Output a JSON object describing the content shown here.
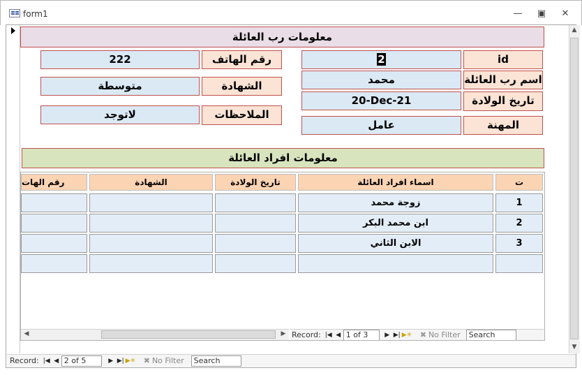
{
  "window": {
    "title": "form1",
    "minimize_icon": "minimize-icon",
    "restore_icon": "restore-icon",
    "close_icon": "close-icon"
  },
  "head_section": {
    "title": "معلومات رب العائلة",
    "fields": {
      "id_label": "id",
      "id_value": "2",
      "name_label": "اسم رب العائلة",
      "name_value": "محمد",
      "dob_label": "تاريخ الولادة",
      "dob_value": "20-Dec-21",
      "job_label": "المهنة",
      "job_value": "عامل",
      "phone_label": "رقم الهاتف",
      "phone_value": "222",
      "degree_label": "الشهادة",
      "degree_value": "متوسطة",
      "notes_label": "الملاحظات",
      "notes_value": "لاتوجد"
    }
  },
  "members_section": {
    "title": "معلومات افراد العائلة",
    "columns": [
      "ت",
      "اسماء افراد العائلة",
      "تاريخ الولادة",
      "الشهادة",
      "رقم الهات"
    ],
    "rows": [
      [
        "1",
        "زوجة محمد",
        "",
        "",
        ""
      ],
      [
        "2",
        "ابن محمد البكر",
        "",
        "",
        ""
      ],
      [
        "3",
        "الابن الثاني",
        "",
        "",
        ""
      ],
      [
        "",
        "",
        "",
        "",
        ""
      ]
    ],
    "nav": {
      "record_label": "Record:",
      "position": "1 of 3",
      "filter": "No Filter",
      "search": "Search"
    }
  },
  "main_nav": {
    "record_label": "Record:",
    "position": "2 of 5",
    "filter": "No Filter",
    "search": "Search"
  },
  "colors": {
    "label_bg": "#fbe4d5",
    "value_bg": "#dbe9f5",
    "border": "#c0504d",
    "head_bg": "#e9dde7",
    "members_head_bg": "#d7e4bd",
    "col_header_bg": "#fbd4b4"
  }
}
